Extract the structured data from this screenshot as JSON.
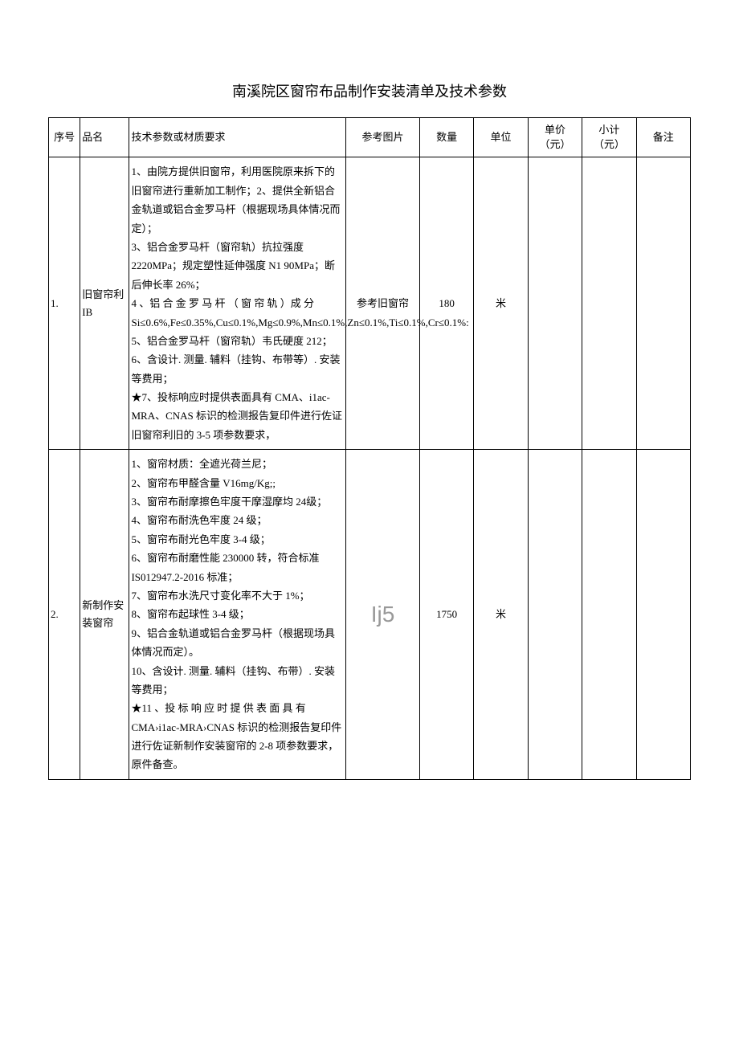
{
  "title": "南溪院区窗帘布品制作安装清单及技术参数",
  "headers": {
    "seq": "序号",
    "name": "品名",
    "spec": "技术参数或材质要求",
    "img": "参考图片",
    "qty": "数量",
    "unit": "单位",
    "price_line1": "单价",
    "price_line2": "（元）",
    "subtotal_line1": "小计",
    "subtotal_line2": "（元）",
    "remark": "备注"
  },
  "rows": [
    {
      "seq": "1.",
      "name": "旧窗帘利IB",
      "spec": "1、由院方提供旧窗帘，利用医院原来拆下的旧窗帘进行重新加工制作；2、提供全新铝合金轨道或铝合金罗马杆（根据现场具体情况而定）；\n3、铝合金罗马杆（窗帘轨）抗拉强度2220MPa；规定塑性延伸强度 N1 90MPa；断后伸长率 26%；\n4 、铝 合 金 罗 马 杆 （ 窗 帘 轨 ）成 分 Si≤0.6%,Fe≤0.35%,Cu≤0.1%,Mg≤0.9%,Mn≤0.1%,Zn≤0.1%,Ti≤0.1%,Cr≤0.1%:\n5、铝合金罗马杆（窗帘轨）韦氏硬度 212；\n6、含设计. 测量. 辅料（挂钩、布带等）. 安装等费用；\n★7、投标响应时提供表面具有 CMA、i1ac-MRA、CNAS 标识的检测报告复印件进行佐证旧窗帘利旧的 3-5 项参数要求，",
      "img": "参考旧窗帘",
      "qty": "180",
      "unit": "米"
    },
    {
      "seq": "2.",
      "name": "新制作安装窗帘",
      "spec": "1、窗帘材质：全遮光荷兰尼；\n2、窗帘布甲醛含量 V16mg/Kg;;\n3、窗帘布耐摩擦色牢度干摩湿摩均 24级；\n4、窗帘布耐洗色牢度 24 级；\n5、窗帘布耐光色牢度 3-4 级；\n6、窗帘布耐磨性能 230000 转，符合标准 IS012947.2-2016 标准；\n7、窗帘布水洗尺寸变化率不大于 1%；\n8、窗帘布起球性 3-4 级；\n9、铝合金轨道或铝合金罗马杆（根据现场具体情况而定）。\n10、含设计. 测量. 辅料（挂钩、布带）. 安装等费用；\n★11 、投 标 响 应 时 提 供 表 面 具 有 CMA›i1ac-MRA›CNAS 标识的检测报告复印件进行佐证新制作安装窗帘的 2-8 项参数要求，原件备查。",
      "img_placeholder": "Ij5",
      "qty": "1750",
      "unit": "米"
    }
  ]
}
